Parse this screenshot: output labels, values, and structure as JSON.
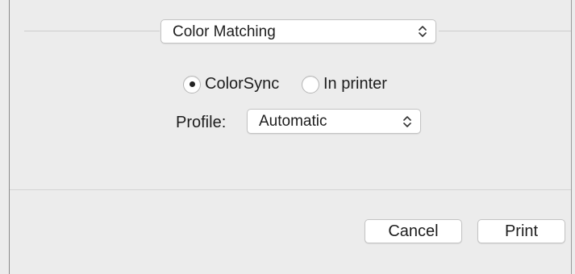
{
  "panel_selector": {
    "value": "Color Matching",
    "icon": "updown-chevron-icon"
  },
  "matching": {
    "options": [
      {
        "label": "ColorSync",
        "selected": true
      },
      {
        "label": "In printer",
        "selected": false
      }
    ]
  },
  "profile": {
    "label": "Profile:",
    "value": "Automatic",
    "icon": "updown-chevron-icon"
  },
  "buttons": {
    "cancel": "Cancel",
    "print": "Print"
  }
}
